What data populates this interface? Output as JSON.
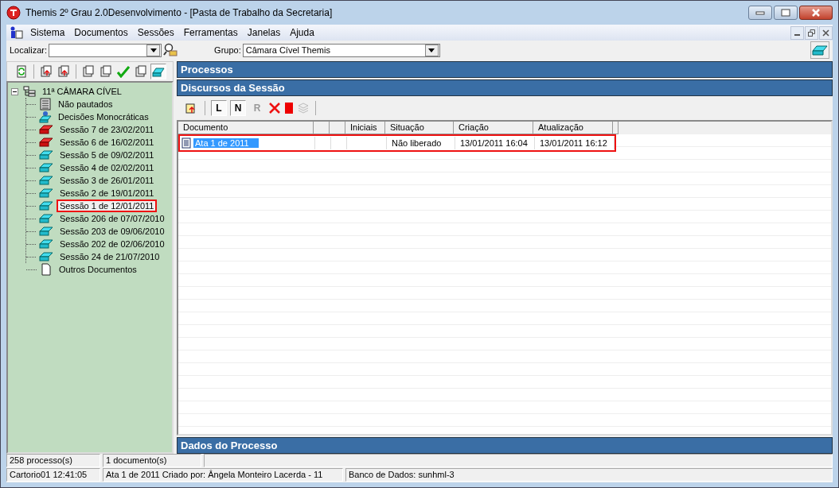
{
  "window": {
    "title": "Themis 2º Grau 2.0Desenvolvimento - [Pasta de Trabalho da Secretaria]"
  },
  "menu": [
    "Sistema",
    "Documentos",
    "Sessões",
    "Ferramentas",
    "Janelas",
    "Ajuda"
  ],
  "search": {
    "label": "Localizar:"
  },
  "group": {
    "label": "Grupo:",
    "value": "Câmara Cível Themis"
  },
  "tree": {
    "label": "11ª CÂMARA CÍVEL",
    "kind": "chamber",
    "expanded": true,
    "children": [
      {
        "label": "Não pautados",
        "kind": "list",
        "selected": false
      },
      {
        "label": "Decisões Monocráticas",
        "kind": "decisions",
        "selected": false
      },
      {
        "label": "Sessão 7 de 23/02/2011",
        "kind": "open-session",
        "selected": false
      },
      {
        "label": "Sessão 6 de 16/02/2011",
        "kind": "open-session",
        "selected": false
      },
      {
        "label": "Sessão 5 de 09/02/2011",
        "kind": "session",
        "selected": false
      },
      {
        "label": "Sessão 4 de 02/02/2011",
        "kind": "session",
        "selected": false
      },
      {
        "label": "Sessão 3 de 26/01/2011",
        "kind": "session",
        "selected": false
      },
      {
        "label": "Sessão 2 de 19/01/2011",
        "kind": "session",
        "selected": false
      },
      {
        "label": "Sessão 1 de 12/01/2011",
        "kind": "session",
        "selected": true
      },
      {
        "label": "Sessão 206 de 07/07/2010",
        "kind": "session",
        "selected": false
      },
      {
        "label": "Sessão 203 de 09/06/2010",
        "kind": "session",
        "selected": false
      },
      {
        "label": "Sessão 202 de 02/06/2010",
        "kind": "session",
        "selected": false
      },
      {
        "label": "Sessão 24 de 21/07/2010",
        "kind": "session",
        "selected": false
      },
      {
        "label": "Outros Documentos",
        "kind": "document",
        "selected": false
      }
    ]
  },
  "panels": {
    "top": "Processos",
    "middle": "Discursos da Sessão",
    "bottom": "Dados do Processo"
  },
  "doc_toolbar": [
    {
      "label": "L",
      "disabled": false
    },
    {
      "label": "N",
      "disabled": false
    },
    {
      "label": "R",
      "disabled": true
    }
  ],
  "table": {
    "columns": [
      "Documento",
      "",
      "",
      "Iniciais",
      "Situação",
      "Criação",
      "Atualização"
    ],
    "rows": [
      {
        "cells": [
          "Ata 1 de 2011",
          "",
          "",
          "",
          "Não liberado",
          "13/01/2011 16:04",
          "13/01/2011 16:12"
        ],
        "selected": true
      }
    ]
  },
  "status_bar": {
    "row_1": [
      "258 processo(s)",
      "1 documento(s)"
    ],
    "row_2": [
      "Cartorio01  12:41:05",
      "Ata 1 de 2011  Criado por: Ângela Monteiro Lacerda - 11",
      "Banco de Dados: sunhml-3"
    ]
  }
}
